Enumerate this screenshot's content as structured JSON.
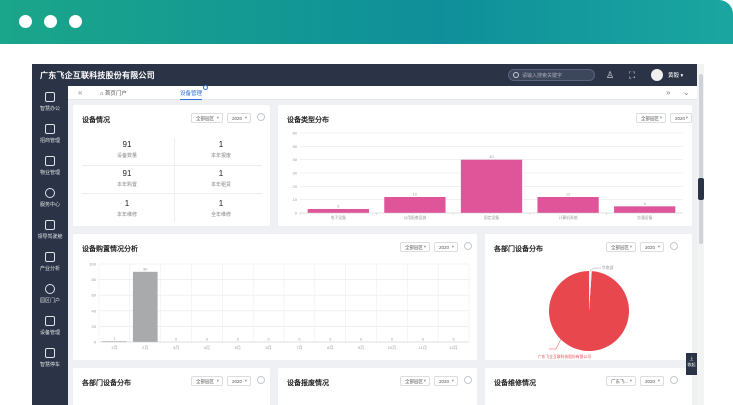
{
  "header": {
    "brand": "广东飞企互联科技股份有限公司",
    "search_placeholder": "请输入搜索关键字",
    "user_name": "黄毅 ▾"
  },
  "sidebar": {
    "items": [
      {
        "label": "智慧办公",
        "icon": "office-icon"
      },
      {
        "label": "招商管理",
        "icon": "investment-icon"
      },
      {
        "label": "物业管理",
        "icon": "property-icon"
      },
      {
        "label": "服务中心",
        "icon": "service-icon"
      },
      {
        "label": "领导驾驶舱",
        "icon": "cockpit-icon"
      },
      {
        "label": "产业分析",
        "icon": "industry-icon"
      },
      {
        "label": "园区门户",
        "icon": "portal-icon"
      },
      {
        "label": "设备管理",
        "icon": "device-icon"
      },
      {
        "label": "智慧停车",
        "icon": "parking-icon"
      }
    ]
  },
  "tabs": {
    "collapse_glyph": "«",
    "home_label": "首页门户",
    "active_label": "设备管理",
    "right_glyph": "»",
    "down_glyph": "⌄"
  },
  "filters": {
    "park": "全部园区",
    "year": "2020",
    "caret": "▾"
  },
  "device_status": {
    "title": "设备情况",
    "stats": [
      {
        "value": "91",
        "label": "设备数量"
      },
      {
        "value": "1",
        "label": "本年报废"
      },
      {
        "value": "91",
        "label": "本年购置"
      },
      {
        "value": "1",
        "label": "本年租赁"
      },
      {
        "value": "1",
        "label": "本年维修"
      },
      {
        "value": "1",
        "label": "全年维修"
      }
    ]
  },
  "device_type_chart": {
    "title": "设备类型分布",
    "y_ticks": [
      "60",
      "50",
      "40",
      "30",
      "20",
      "10",
      "0"
    ],
    "categories": [
      "电子设备",
      "公用配套设施",
      "固定设备",
      "计算机系统",
      "交通设备"
    ],
    "values": [
      3,
      12,
      40,
      12,
      5
    ]
  },
  "purchase_chart": {
    "title": "设备购置情况分析",
    "y_ticks": [
      "100",
      "80",
      "60",
      "40",
      "20",
      "0"
    ],
    "months": [
      "1月",
      "2月",
      "3月",
      "4月",
      "5月",
      "6月",
      "7月",
      "8月",
      "9月",
      "10月",
      "11月",
      "12月"
    ],
    "values": [
      1,
      90,
      0,
      0,
      0,
      0,
      0,
      0,
      0,
      0,
      0,
      0
    ]
  },
  "dept_chart": {
    "title": "各部门设备分布",
    "slices": [
      {
        "label": "广东飞企互联科技股份有限公司",
        "value": 90
      },
      {
        "label": "华南部",
        "value": 1
      }
    ],
    "colors": {
      "main": "#e8474e",
      "minor": "#f2f2f2"
    }
  },
  "bottom_cards": {
    "dept_title": "各部门设备分布",
    "scrap_title": "设备报废情况",
    "repair_title": "设备维修情况",
    "repair_select": "广东飞..."
  },
  "misc": {
    "corner_tab": "上\n收起"
  },
  "colors": {
    "nav_bg": "#2b3446",
    "bar_pink": "#e0559a",
    "bar_gray": "#a9aaab",
    "accent": "#2f6fd6",
    "header_gradient": "#1aa68a"
  }
}
